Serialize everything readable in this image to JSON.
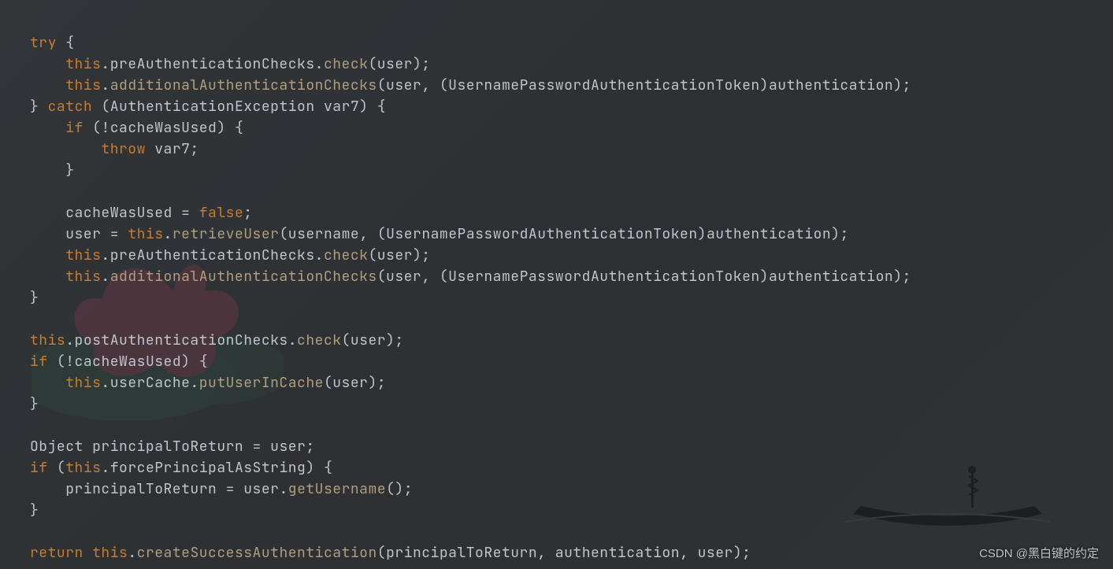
{
  "watermark": "CSDN @黑白键的约定",
  "kw": {
    "try": "try",
    "catch": "catch",
    "if": "if",
    "throw": "throw",
    "return": "return",
    "this": "this",
    "false": "false"
  },
  "fn": {
    "check": "check",
    "additionalAuthenticationChecks": "additionalAuthenticationChecks",
    "retrieveUser": "retrieveUser",
    "putUserInCache": "putUserInCache",
    "getUsername": "getUsername",
    "createSuccessAuthentication": "createSuccessAuthentication"
  },
  "id": {
    "preAuthenticationChecks": "preAuthenticationChecks",
    "postAuthenticationChecks": "postAuthenticationChecks",
    "user": "user",
    "username": "username",
    "UsernamePasswordAuthenticationToken": "UsernamePasswordAuthenticationToken",
    "authentication": "authentication",
    "AuthenticationException": "AuthenticationException",
    "var7": "var7",
    "cacheWasUsed": "cacheWasUsed",
    "userCache": "userCache",
    "Object": "Object",
    "principalToReturn": "principalToReturn",
    "forcePrincipalAsString": "forcePrincipalAsString"
  },
  "p": {
    "space": " ",
    "obrace": "{",
    "cbrace": "}",
    "oparen": "(",
    "cparen": ")",
    "semi": ";",
    "comma": ",",
    "dot": ".",
    "bang": "!",
    "eq": "="
  }
}
